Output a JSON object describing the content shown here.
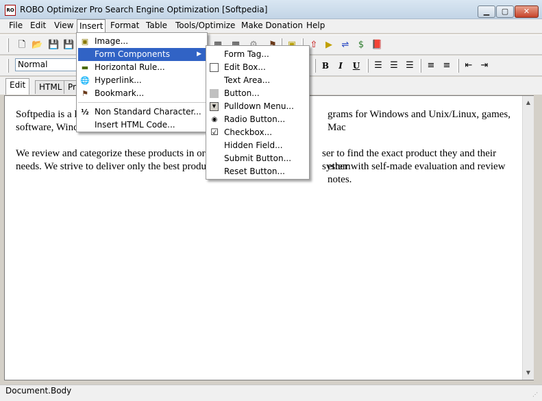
{
  "window": {
    "title": "ROBO Optimizer Pro Search Engine Optimization [Softpedia]",
    "app_icon": "RO",
    "controls": {
      "minimize": "▁",
      "maximize": "▢",
      "close": "✕"
    }
  },
  "menubar": [
    "File",
    "Edit",
    "View",
    "Insert",
    "Format",
    "Table",
    "Tools/Optimize",
    "Make Donation",
    "Help"
  ],
  "toolbar": {
    "style_value": "Normal",
    "bold": "B",
    "italic": "I",
    "underline": "U"
  },
  "tabs": [
    "Edit",
    "HTML",
    "Pre"
  ],
  "editor": {
    "paragraph1": "Softpedia is a l                                                    grams for Windows and Unix/Linux, games, Mac software, Wind",
    "p1_line1_left": "Softpedia is a l",
    "p1_line1_right": "grams for Windows and Unix/Linux, games, Mac",
    "p1_line2_left": "software, Wind",
    "p2_line1_left": "We review and categorize these products in or",
    "p2_line1_right": "ser to find the exact product they and their system",
    "p2_line2_left": "needs. We strive to deliver only the best produ",
    "p2_line2_right": "ether with self-made evaluation and review notes."
  },
  "insert_menu": {
    "items": [
      {
        "label": "Image...",
        "icon": "image-icon"
      },
      {
        "label": "Form Components",
        "icon": "",
        "submenu": true
      },
      {
        "label": "Horizontal Rule...",
        "icon": "horizontal-rule-icon"
      },
      {
        "label": "Hyperlink...",
        "icon": "globe-icon"
      },
      {
        "label": "Bookmark...",
        "icon": "bookmark-flag-icon"
      },
      {
        "label": "Non Standard Character...",
        "icon": "one-half-icon",
        "glyph": "½"
      },
      {
        "label": "Insert HTML Code...",
        "icon": ""
      }
    ]
  },
  "form_menu": {
    "items": [
      {
        "label": "Form Tag..."
      },
      {
        "label": "Edit Box..."
      },
      {
        "label": "Text Area..."
      },
      {
        "label": "Button..."
      },
      {
        "label": "Pulldown Menu..."
      },
      {
        "label": "Radio Button..."
      },
      {
        "label": "Checkbox..."
      },
      {
        "label": "Hidden Field..."
      },
      {
        "label": "Submit Button..."
      },
      {
        "label": "Reset Button..."
      }
    ]
  },
  "status": {
    "text": "Document.Body"
  }
}
